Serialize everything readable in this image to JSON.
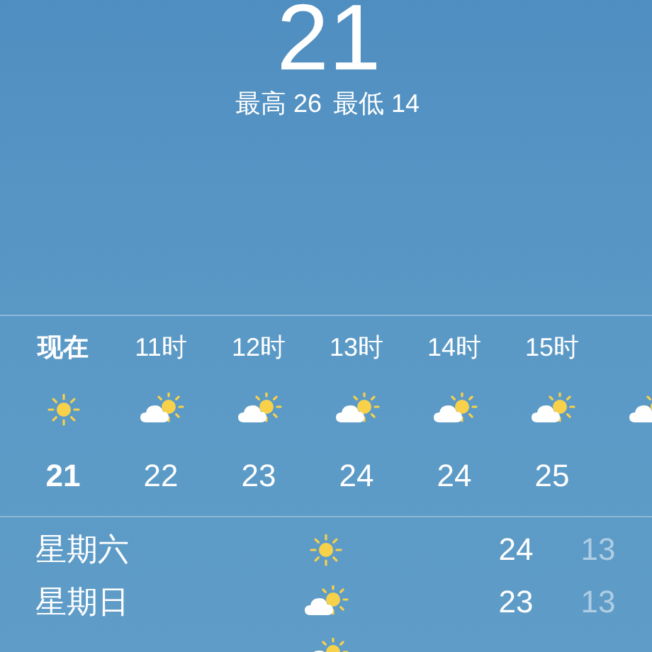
{
  "current": {
    "temperature": "21",
    "high": "最高 26",
    "low": "最低 14"
  },
  "hourly": [
    {
      "time": "现在",
      "kind": "sunny",
      "temperature": "21",
      "current": true
    },
    {
      "time": "11时",
      "kind": "partly_cloudy",
      "temperature": "22",
      "current": false
    },
    {
      "time": "12时",
      "kind": "partly_cloudy",
      "temperature": "23",
      "current": false
    },
    {
      "time": "13时",
      "kind": "partly_cloudy",
      "temperature": "24",
      "current": false
    },
    {
      "time": "14时",
      "kind": "partly_cloudy",
      "temperature": "24",
      "current": false
    },
    {
      "time": "15时",
      "kind": "partly_cloudy",
      "temperature": "25",
      "current": false
    },
    {
      "kind": "partly_cloudy"
    }
  ],
  "daily": [
    {
      "day": "星期六",
      "kind": "sunny",
      "high": "24",
      "low": "13"
    },
    {
      "day": "星期日",
      "kind": "partly_cloudy",
      "high": "23",
      "low": "13"
    },
    {
      "kind": "partly_cloudy"
    }
  ]
}
